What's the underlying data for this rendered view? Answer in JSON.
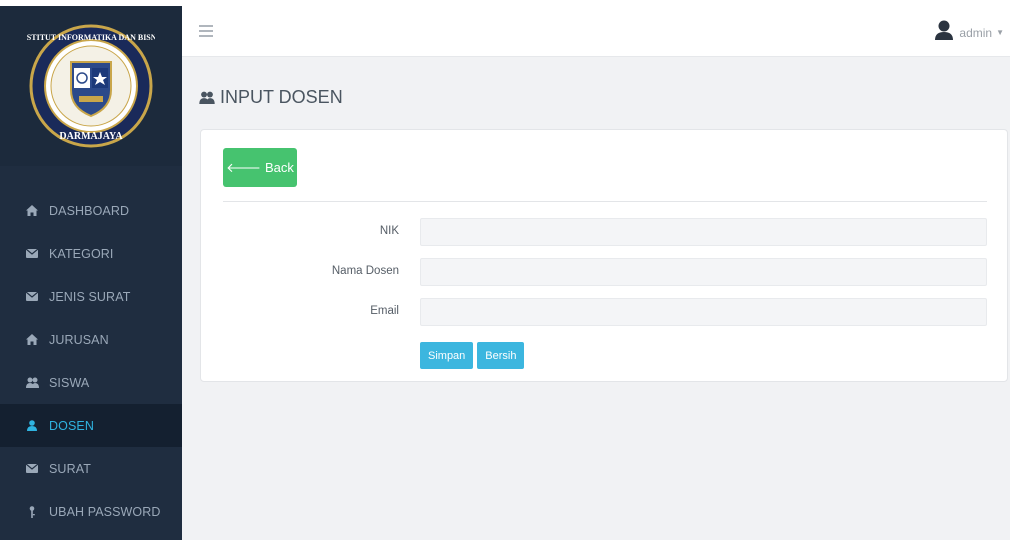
{
  "logo": {
    "ring_text_top": "INSTITUT INFORMATIKA DAN BISNIS",
    "ring_text_bottom": "DARMAJAYA"
  },
  "sidebar": {
    "items": [
      {
        "label": "DASHBOARD",
        "icon": "home-icon",
        "active": false
      },
      {
        "label": "KATEGORI",
        "icon": "envelope-icon",
        "active": false
      },
      {
        "label": "JENIS SURAT",
        "icon": "envelope-icon",
        "active": false
      },
      {
        "label": "JURUSAN",
        "icon": "home-icon",
        "active": false
      },
      {
        "label": "SISWA",
        "icon": "users-icon",
        "active": false
      },
      {
        "label": "DOSEN",
        "icon": "user-icon",
        "active": true
      },
      {
        "label": "SURAT",
        "icon": "envelope-icon",
        "active": false
      },
      {
        "label": "UBAH PASSWORD",
        "icon": "key-icon",
        "active": false
      }
    ]
  },
  "topbar": {
    "menu_icon": "hamburger-icon",
    "user_name": "admin",
    "user_icon": "user-avatar-icon",
    "caret_icon": "caret-down-icon"
  },
  "page": {
    "title": "INPUT DOSEN",
    "title_icon": "users-icon"
  },
  "form": {
    "back_label": "Back",
    "fields": [
      {
        "label": "NIK",
        "value": "",
        "placeholder": ""
      },
      {
        "label": "Nama Dosen",
        "value": "",
        "placeholder": ""
      },
      {
        "label": "Email",
        "value": "",
        "placeholder": ""
      }
    ],
    "save_label": "Simpan",
    "clear_label": "Bersih"
  },
  "colors": {
    "sidebar_bg": "#1f2d40",
    "active_text": "#2fb3e0",
    "back_button": "#46c36f",
    "primary_button": "#3cb6df",
    "content_bg": "#f1f2f4"
  }
}
